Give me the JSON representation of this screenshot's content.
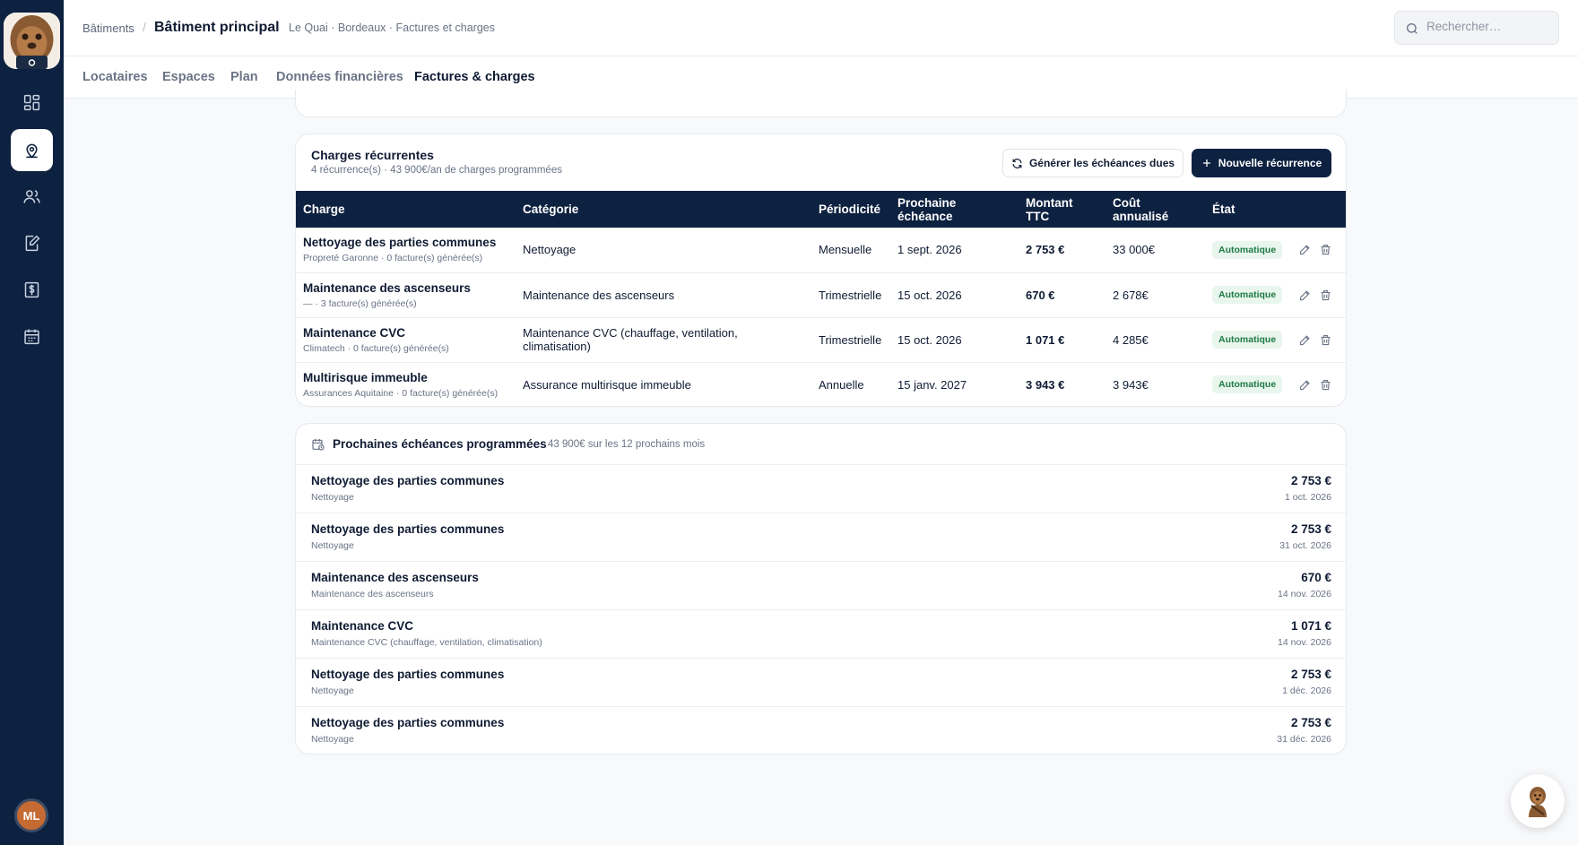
{
  "sidebar": {
    "logo_icon": "chewbacca-mascot-icon",
    "items": [
      {
        "name": "dashboard",
        "icon": "grid-icon",
        "active": false
      },
      {
        "name": "buildings",
        "icon": "map-pin-icon",
        "active": true
      },
      {
        "name": "tenants",
        "icon": "users-icon",
        "active": false
      },
      {
        "name": "documents",
        "icon": "edit-document-icon",
        "active": false
      },
      {
        "name": "finance",
        "icon": "dollar-document-icon",
        "active": false
      },
      {
        "name": "calendar",
        "icon": "calendar-icon",
        "active": false
      }
    ],
    "user_initials": "ML"
  },
  "header": {
    "breadcrumb_root": "Bâtiments",
    "breadcrumb_separator": "/",
    "title": "Bâtiment principal",
    "subtitle": "Le Quai · Bordeaux · Factures et charges",
    "search_placeholder": "Rechercher…"
  },
  "tabs": [
    {
      "label": "Locataires",
      "active": false
    },
    {
      "label": "Espaces",
      "active": false
    },
    {
      "label": "Plan",
      "active": false
    },
    {
      "label": "Données financières",
      "active": false
    },
    {
      "label": "Factures & charges",
      "active": true
    }
  ],
  "recurring": {
    "title": "Charges récurrentes",
    "subtitle": "4 récurrence(s) · 43 900€/an de charges programmées",
    "generate_label": "Générer les échéances dues",
    "new_label": "Nouvelle récurrence",
    "columns": [
      "Charge",
      "Catégorie",
      "Périodicité",
      "Prochaine échéance",
      "Montant TTC",
      "Coût annualisé",
      "État"
    ],
    "rows": [
      {
        "name": "Nettoyage des parties communes",
        "meta": "Propreté Garonne · 0 facture(s) générée(s)",
        "category": "Nettoyage",
        "period": "Mensuelle",
        "next": "1 sept. 2026",
        "amount": "2 753 €",
        "annual": "33 000€",
        "state": "Automatique"
      },
      {
        "name": "Maintenance des ascenseurs",
        "meta": "— · 3 facture(s) générée(s)",
        "category": "Maintenance des ascenseurs",
        "period": "Trimestrielle",
        "next": "15 oct. 2026",
        "amount": "670 €",
        "annual": "2 678€",
        "state": "Automatique"
      },
      {
        "name": "Maintenance CVC",
        "meta": "Climatech · 0 facture(s) générée(s)",
        "category": "Maintenance CVC (chauffage, ventilation, climatisation)",
        "period": "Trimestrielle",
        "next": "15 oct. 2026",
        "amount": "1 071 €",
        "annual": "4 285€",
        "state": "Automatique"
      },
      {
        "name": "Multirisque immeuble",
        "meta": "Assurances Aquitaine · 0 facture(s) générée(s)",
        "category": "Assurance multirisque immeuble",
        "period": "Annuelle",
        "next": "15 janv. 2027",
        "amount": "3 943 €",
        "annual": "3 943€",
        "state": "Automatique"
      }
    ]
  },
  "upcoming": {
    "title": "Prochaines échéances programmées",
    "subtitle": "43 900€ sur les 12 prochains mois",
    "items": [
      {
        "name": "Nettoyage des parties communes",
        "category": "Nettoyage",
        "amount": "2 753 €",
        "date": "1 oct. 2026"
      },
      {
        "name": "Nettoyage des parties communes",
        "category": "Nettoyage",
        "amount": "2 753 €",
        "date": "31 oct. 2026"
      },
      {
        "name": "Maintenance des ascenseurs",
        "category": "Maintenance des ascenseurs",
        "amount": "670 €",
        "date": "14 nov. 2026"
      },
      {
        "name": "Maintenance CVC",
        "category": "Maintenance CVC (chauffage, ventilation, climatisation)",
        "amount": "1 071 €",
        "date": "14 nov. 2026"
      },
      {
        "name": "Nettoyage des parties communes",
        "category": "Nettoyage",
        "amount": "2 753 €",
        "date": "1 déc. 2026"
      },
      {
        "name": "Nettoyage des parties communes",
        "category": "Nettoyage",
        "amount": "2 753 €",
        "date": "31 déc. 2026"
      }
    ]
  },
  "assistant_icon": "chewbacca-assistant-icon",
  "colors": {
    "navy": "#0d2140",
    "badge_bg": "#e9f6ee",
    "badge_text": "#1e7a45",
    "avatar": "#c46a32"
  }
}
